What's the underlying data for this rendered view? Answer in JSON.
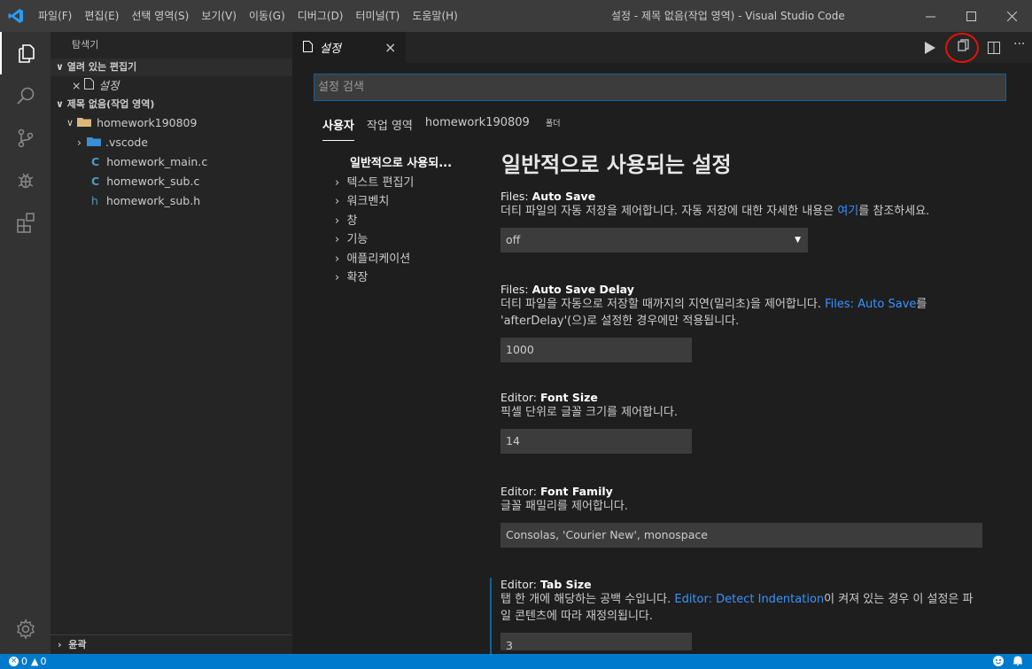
{
  "window": {
    "title": "설정 - 제목 없음(작업 영역) - Visual Studio Code"
  },
  "menu": [
    "파일(F)",
    "편집(E)",
    "선택 영역(S)",
    "보기(V)",
    "이동(G)",
    "디버그(D)",
    "터미널(T)",
    "도움말(H)"
  ],
  "sidebar": {
    "header": "탐색기",
    "open_editors_label": "열려 있는 편집기",
    "open_editor_item": "설정",
    "workspace_label": "제목 없음(작업 영역)",
    "root_folder": "homework190809",
    "tree": [
      ".vscode",
      "homework_main.c",
      "homework_sub.c",
      "homework_sub.h"
    ],
    "outline_label": "윤곽"
  },
  "tab": {
    "label": "설정"
  },
  "search": {
    "placeholder": "설정 검색"
  },
  "scopes": {
    "user": "사용자",
    "workspace": "작업 영역",
    "folder": "homework190809",
    "folder_suffix": "폴더"
  },
  "toc": {
    "active": "일반적으로 사용되...",
    "items": [
      "텍스트 편집기",
      "워크벤치",
      "창",
      "기능",
      "애플리케이션",
      "확장"
    ]
  },
  "section_title": "일반적으로 사용되는 설정",
  "settings": {
    "auto_save": {
      "prefix": "Files: ",
      "name": "Auto Save",
      "desc_a": "더티 파일의 자동 저장을 제어합니다. 자동 저장에 대한 자세한 내용은 ",
      "desc_link": "여기",
      "desc_b": "를 참조하세요.",
      "value": "off"
    },
    "auto_save_delay": {
      "prefix": "Files: ",
      "name": "Auto Save Delay",
      "desc_a": "더티 파일을 자동으로 저장할 때까지의 지연(밀리초)을 제어합니다. ",
      "desc_link": "Files: Auto Save",
      "desc_b": "를",
      "desc_c": "'afterDelay'(으)로 설정한 경우에만 적용됩니다.",
      "value": "1000"
    },
    "font_size": {
      "prefix": "Editor: ",
      "name": "Font Size",
      "desc": "픽셀 단위로 글꼴 크기를 제어합니다.",
      "value": "14"
    },
    "font_family": {
      "prefix": "Editor: ",
      "name": "Font Family",
      "desc": "글꼴 패밀리를 제어합니다.",
      "value": "Consolas, 'Courier New', monospace"
    },
    "tab_size": {
      "prefix": "Editor: ",
      "name": "Tab Size",
      "desc_a": "탭 한 개에 해당하는 공백 수입니다. ",
      "desc_link": "Editor: Detect Indentation",
      "desc_b": "이 켜져 있는 경우 이 설정은 파",
      "desc_c": "일 콘텐츠에 따라 재정의됩니다.",
      "value": "3"
    }
  },
  "status": {
    "errors": "0",
    "warnings": "0"
  },
  "colors": {
    "accent": "#007acc",
    "link": "#3794ff",
    "highlight_circle": "#e51400"
  }
}
